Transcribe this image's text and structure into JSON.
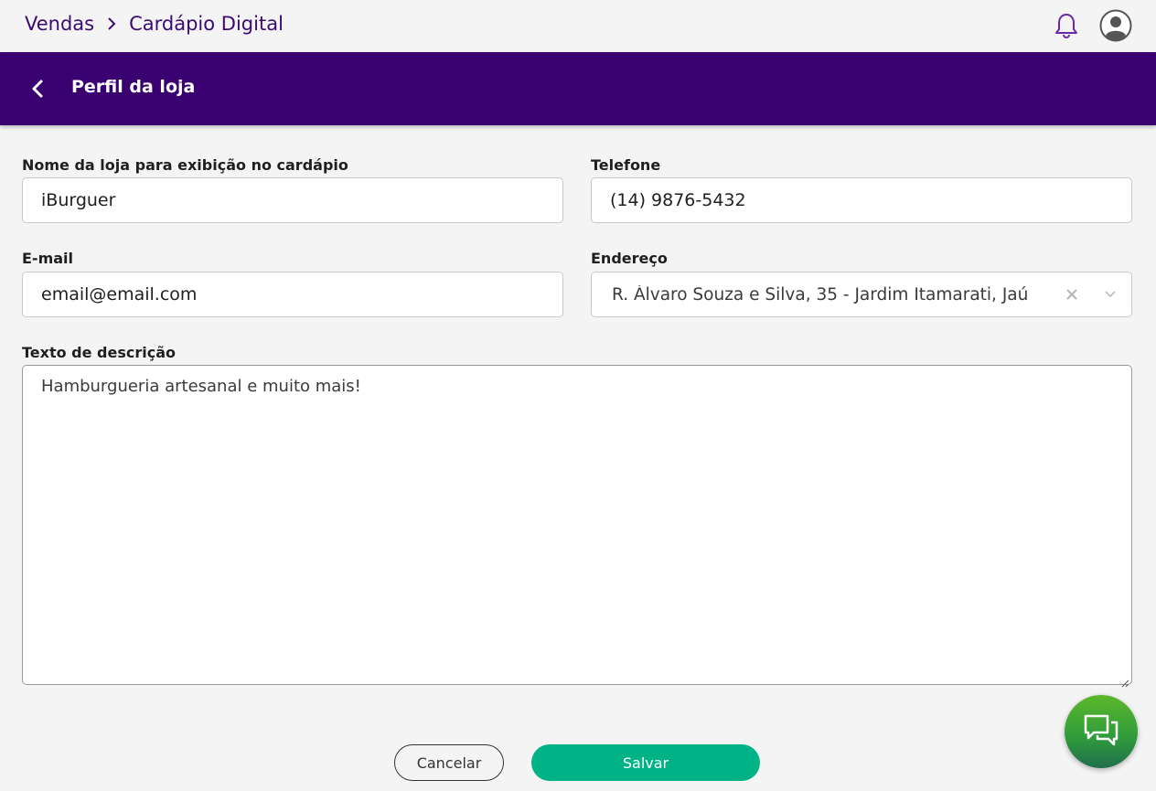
{
  "breadcrumb": {
    "parent": "Vendas",
    "current": "Cardápio Digital"
  },
  "page": {
    "title": "Perfil da loja"
  },
  "form": {
    "store_name": {
      "label": "Nome da loja para exibição no cardápio",
      "value": "iBurguer"
    },
    "phone": {
      "label": "Telefone",
      "value": "(14) 9876-5432"
    },
    "email": {
      "label": "E-mail",
      "value": "email@email.com"
    },
    "address": {
      "label": "Endereço",
      "value": "R. Álvaro Souza e Silva, 35 - Jardim Itamarati, Jaú"
    },
    "description": {
      "label": "Texto de descrição",
      "value": "Hamburgueria artesanal e muito mais!"
    }
  },
  "actions": {
    "cancel_label": "Cancelar",
    "save_label": "Salvar"
  },
  "colors": {
    "brand": "#3b0070",
    "accent": "#00b386",
    "breadcrumb": "#3b0a73"
  },
  "icons": {
    "notification": "bell-icon",
    "user": "user-avatar-icon",
    "back": "chevron-left-icon",
    "chat": "chat-bubbles-icon"
  }
}
